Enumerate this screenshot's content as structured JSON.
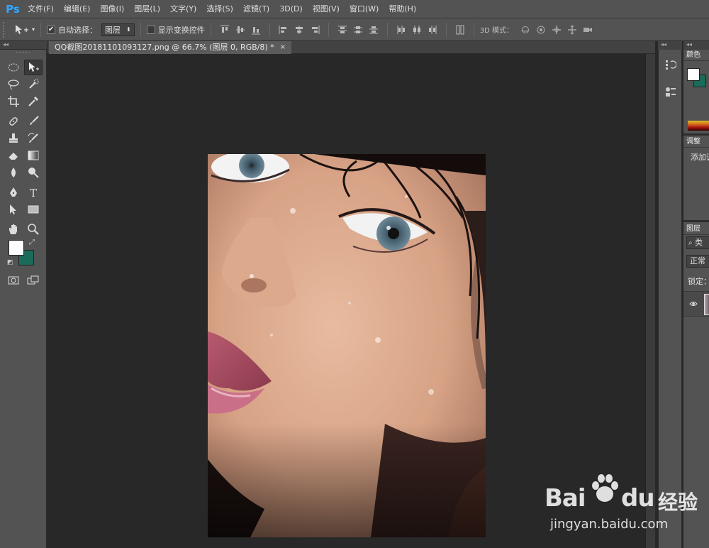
{
  "app": {
    "logo": "Ps",
    "menu": [
      "文件(F)",
      "编辑(E)",
      "图像(I)",
      "图层(L)",
      "文字(Y)",
      "选择(S)",
      "滤镜(T)",
      "3D(D)",
      "视图(V)",
      "窗口(W)",
      "帮助(H)"
    ]
  },
  "options": {
    "auto_select_label": "自动选择：",
    "auto_select_checked": true,
    "auto_select_value": "图层",
    "show_transform_label": "显示变换控件",
    "show_transform_checked": false,
    "mode_3d_label": "3D 模式："
  },
  "document": {
    "tab_title": "QQ截图20181101093127.png @ 66.7% (图层 0, RGB/8) *",
    "close_glyph": "×"
  },
  "colors": {
    "foreground": "#ffffff",
    "background": "#1a6b5a",
    "ui_bg": "#535353",
    "canvas_bg": "#282828"
  },
  "panels": {
    "color_tab": "颜色",
    "adjust_tab": "调整",
    "adjust_hint": "添加调",
    "layers_tab": "图层",
    "layers_filter": "类",
    "blend_mode": "正常",
    "lock_label": "锁定："
  },
  "watermark": {
    "brand": "Bai",
    "brand_end": "du",
    "cn": "经验",
    "url": "jingyan.baidu.com"
  }
}
